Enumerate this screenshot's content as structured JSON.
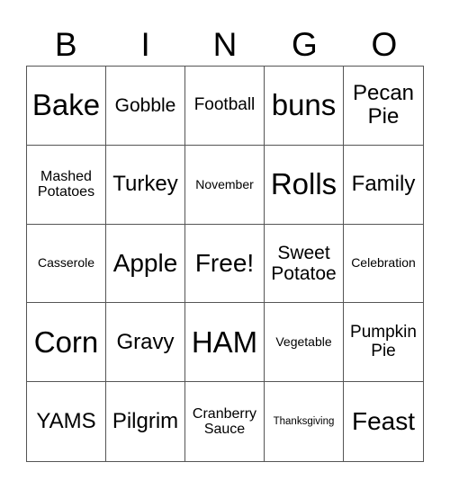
{
  "header": {
    "letters": [
      "B",
      "I",
      "N",
      "G",
      "O"
    ]
  },
  "cells": [
    {
      "text": "Bake",
      "size": "s-xl"
    },
    {
      "text": "Gobble",
      "size": "s-m"
    },
    {
      "text": "Football",
      "size": "s-s"
    },
    {
      "text": "buns",
      "size": "s-xl"
    },
    {
      "text": "Pecan Pie",
      "size": "s-m2"
    },
    {
      "text": "Mashed Potatoes",
      "size": "s-xs"
    },
    {
      "text": "Turkey",
      "size": "s-m2"
    },
    {
      "text": "November",
      "size": "s-xxs"
    },
    {
      "text": "Rolls",
      "size": "s-xl"
    },
    {
      "text": "Family",
      "size": "s-m2"
    },
    {
      "text": "Casserole",
      "size": "s-xxs"
    },
    {
      "text": "Apple",
      "size": "s-l"
    },
    {
      "text": "Free!",
      "size": "s-l"
    },
    {
      "text": "Sweet Potatoe",
      "size": "s-m"
    },
    {
      "text": "Celebration",
      "size": "s-xxs"
    },
    {
      "text": "Corn",
      "size": "s-xl"
    },
    {
      "text": "Gravy",
      "size": "s-m2"
    },
    {
      "text": "HAM",
      "size": "s-xl"
    },
    {
      "text": "Vegetable",
      "size": "s-xxs"
    },
    {
      "text": "Pumpkin Pie",
      "size": "s-s"
    },
    {
      "text": "YAMS",
      "size": "s-m2"
    },
    {
      "text": "Pilgrim",
      "size": "s-m2"
    },
    {
      "text": "Cranberry Sauce",
      "size": "s-xs"
    },
    {
      "text": "Thanksgiving",
      "size": "s-tiny"
    },
    {
      "text": "Feast",
      "size": "s-l"
    }
  ]
}
